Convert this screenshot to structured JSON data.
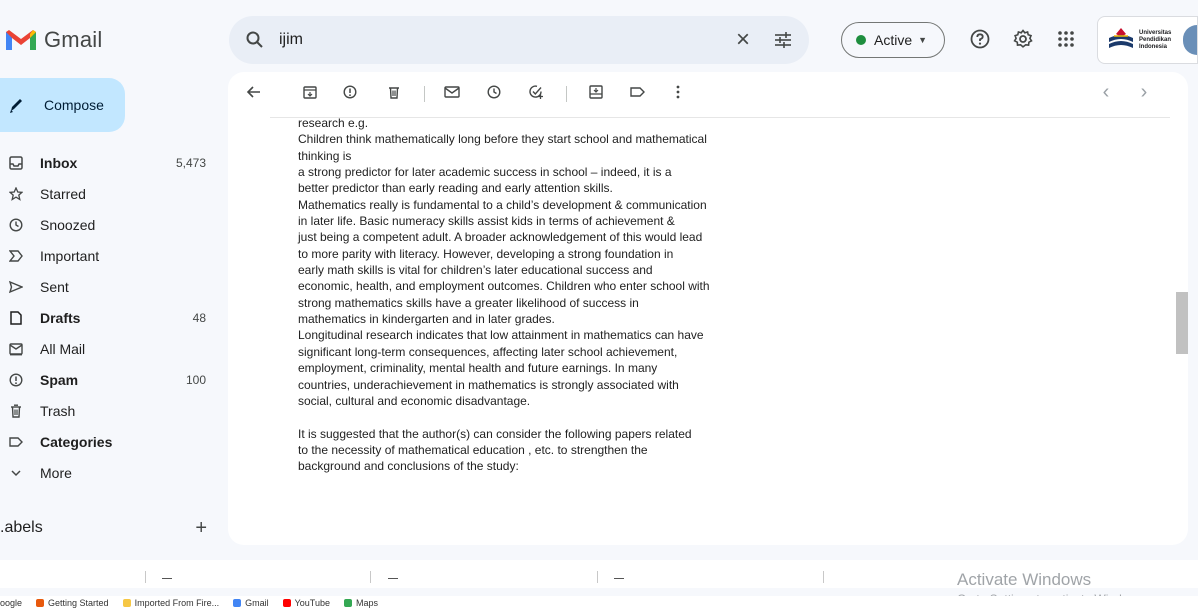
{
  "app": {
    "name": "Gmail",
    "brand_colors": {
      "red": "#ea4335",
      "blue": "#4285f4",
      "green": "#34a853",
      "yellow": "#fbbc04"
    }
  },
  "search": {
    "query": "ijim",
    "search_icon": "search-icon",
    "clear_icon": "close-icon",
    "filter_icon": "tune-icon"
  },
  "status": {
    "label": "Active",
    "color": "#1e8e3e"
  },
  "header_icons": [
    "help-icon",
    "settings-icon",
    "apps-icon"
  ],
  "account": {
    "org_line1": "Universitas",
    "org_line2": "Pendidikan",
    "org_line3": "Indonesia"
  },
  "compose": {
    "label": "Compose"
  },
  "nav": [
    {
      "label": "Inbox",
      "count": "5,473",
      "bold": true,
      "icon": "inbox-icon"
    },
    {
      "label": "Starred",
      "count": "",
      "bold": false,
      "icon": "star-icon"
    },
    {
      "label": "Snoozed",
      "count": "",
      "bold": false,
      "icon": "clock-icon"
    },
    {
      "label": "Important",
      "count": "",
      "bold": false,
      "icon": "important-icon"
    },
    {
      "label": "Sent",
      "count": "",
      "bold": false,
      "icon": "send-icon"
    },
    {
      "label": "Drafts",
      "count": "48",
      "bold": true,
      "icon": "draft-icon"
    },
    {
      "label": "All Mail",
      "count": "",
      "bold": false,
      "icon": "all-mail-icon"
    },
    {
      "label": "Spam",
      "count": "100",
      "bold": true,
      "icon": "spam-icon"
    },
    {
      "label": "Trash",
      "count": "",
      "bold": false,
      "icon": "trash-icon"
    },
    {
      "label": "Categories",
      "count": "",
      "bold": true,
      "icon": "label-icon"
    },
    {
      "label": "More",
      "count": "",
      "bold": false,
      "icon": "chevron-down-icon"
    }
  ],
  "labels_section": {
    "title": "Labels",
    "visible_title": ".abels",
    "add_icon": "plus-icon"
  },
  "toolbar": {
    "icons": [
      "back-icon",
      "archive-icon",
      "report-spam-icon",
      "delete-icon",
      "mark-unread-icon",
      "snooze-icon",
      "add-task-icon",
      "move-to-icon",
      "label-icon",
      "more-icon"
    ],
    "pager_prev": "‹",
    "pager_next": "›"
  },
  "message": {
    "lines": [
      "research e.g.",
      "Children think mathematically long before they start school and mathematical",
      "thinking is",
      "a strong predictor for later academic success in school – indeed, it is a",
      "better predictor than early reading and early attention skills.",
      "Mathematics really is fundamental to a child’s development & communication",
      "in later life. Basic numeracy skills assist kids in terms of achievement &",
      "just being a competent adult. A broader acknowledgement of this would lead",
      "to more parity with literacy. However, developing a strong foundation in",
      "early math skills is vital for children’s later educational success and",
      "economic, health, and employment outcomes. Children who enter school with",
      "strong mathematics skills have a greater likelihood of success in",
      "mathematics in kindergarten and in later grades.",
      "Longitudinal research indicates that low attainment in mathematics can have",
      "significant long-term consequences, affecting later school achievement,",
      "employment, criminality, mental health and future earnings. In many",
      "countries, underachievement in mathematics is strongly associated with",
      "social, cultural and economic disadvantage.",
      "",
      "It is suggested that the author(s) can consider the following papers related",
      "to the necessity of mathematical education , etc. to strengthen the",
      "background and conclusions of the study:"
    ]
  },
  "watermark": {
    "line1": "Activate Windows",
    "line2": "Go to Settings to activate Windows."
  },
  "bookmarks": [
    {
      "label": "oogle",
      "color": "#4285f4"
    },
    {
      "label": "Getting Started",
      "color": "#e8590c"
    },
    {
      "label": "Imported From Fire...",
      "color": "#f6c744"
    },
    {
      "label": "Gmail",
      "color": "#4285f4"
    },
    {
      "label": "YouTube",
      "color": "#ff0000"
    },
    {
      "label": "Maps",
      "color": "#34a853"
    }
  ]
}
